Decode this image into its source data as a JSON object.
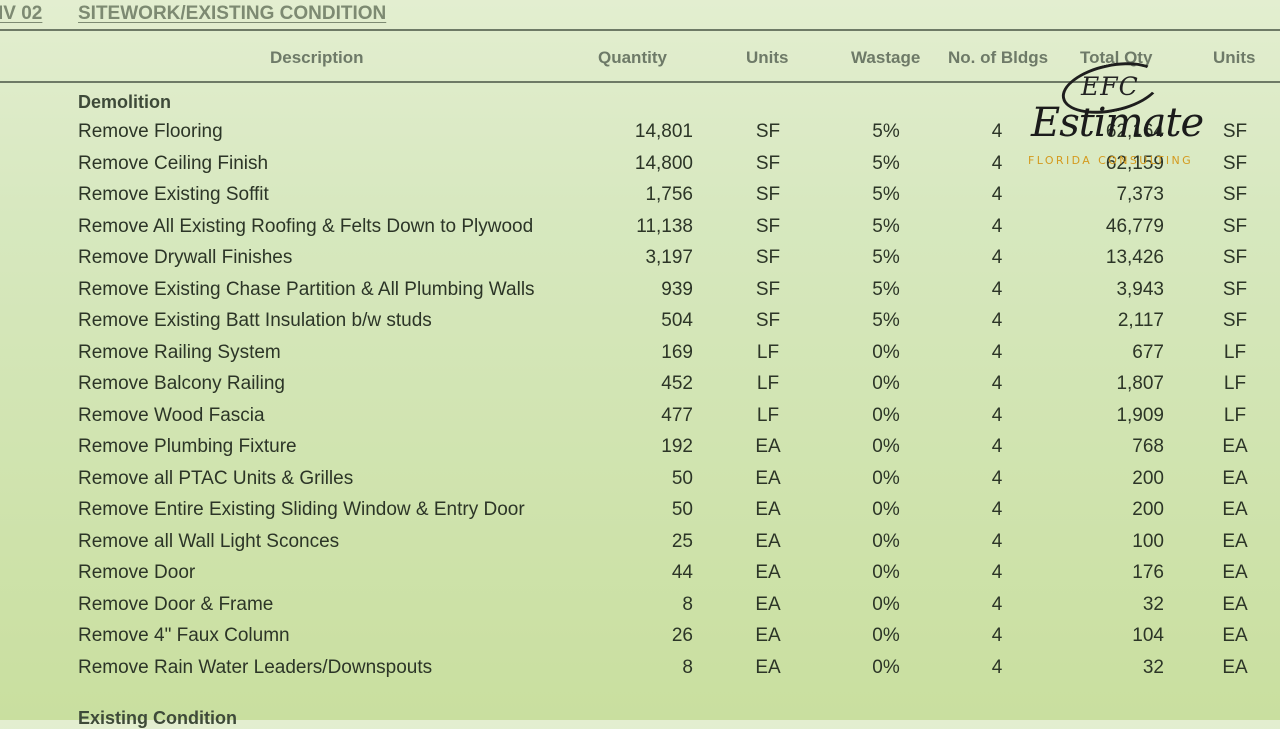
{
  "division": {
    "code": "IV 02",
    "title": "SITEWORK/EXISTING CONDITION"
  },
  "columns": {
    "description": "Description",
    "quantity": "Quantity",
    "units": "Units",
    "wastage": "Wastage",
    "buildings": "No. of Bldgs",
    "total_qty": "Total Qty",
    "total_units": "Units"
  },
  "sections": {
    "demolition": "Demolition",
    "existing": "Existing Condition"
  },
  "rows": [
    {
      "description": "Remove Flooring",
      "quantity": "14,801",
      "units": "SF",
      "wastage": "5%",
      "buildings": "4",
      "total_qty": "62,164",
      "total_units": "SF"
    },
    {
      "description": "Remove Ceiling Finish",
      "quantity": "14,800",
      "units": "SF",
      "wastage": "5%",
      "buildings": "4",
      "total_qty": "62,159",
      "total_units": "SF"
    },
    {
      "description": "Remove Existing Soffit",
      "quantity": "1,756",
      "units": "SF",
      "wastage": "5%",
      "buildings": "4",
      "total_qty": "7,373",
      "total_units": "SF"
    },
    {
      "description": "Remove All Existing Roofing & Felts Down to Plywood",
      "quantity": "11,138",
      "units": "SF",
      "wastage": "5%",
      "buildings": "4",
      "total_qty": "46,779",
      "total_units": "SF"
    },
    {
      "description": "Remove Drywall Finishes",
      "quantity": "3,197",
      "units": "SF",
      "wastage": "5%",
      "buildings": "4",
      "total_qty": "13,426",
      "total_units": "SF"
    },
    {
      "description": "Remove Existing Chase Partition & All Plumbing Walls",
      "quantity": "939",
      "units": "SF",
      "wastage": "5%",
      "buildings": "4",
      "total_qty": "3,943",
      "total_units": "SF"
    },
    {
      "description": "Remove Existing Batt Insulation b/w studs",
      "quantity": "504",
      "units": "SF",
      "wastage": "5%",
      "buildings": "4",
      "total_qty": "2,117",
      "total_units": "SF"
    },
    {
      "description": "Remove Railing System",
      "quantity": "169",
      "units": "LF",
      "wastage": "0%",
      "buildings": "4",
      "total_qty": "677",
      "total_units": "LF"
    },
    {
      "description": "Remove Balcony Railing",
      "quantity": "452",
      "units": "LF",
      "wastage": "0%",
      "buildings": "4",
      "total_qty": "1,807",
      "total_units": "LF"
    },
    {
      "description": "Remove Wood Fascia",
      "quantity": "477",
      "units": "LF",
      "wastage": "0%",
      "buildings": "4",
      "total_qty": "1,909",
      "total_units": "LF"
    },
    {
      "description": "Remove Plumbing Fixture",
      "quantity": "192",
      "units": "EA",
      "wastage": "0%",
      "buildings": "4",
      "total_qty": "768",
      "total_units": "EA"
    },
    {
      "description": "Remove all PTAC Units & Grilles",
      "quantity": "50",
      "units": "EA",
      "wastage": "0%",
      "buildings": "4",
      "total_qty": "200",
      "total_units": "EA"
    },
    {
      "description": "Remove Entire Existing Sliding Window & Entry Door",
      "quantity": "50",
      "units": "EA",
      "wastage": "0%",
      "buildings": "4",
      "total_qty": "200",
      "total_units": "EA"
    },
    {
      "description": "Remove all Wall Light Sconces",
      "quantity": "25",
      "units": "EA",
      "wastage": "0%",
      "buildings": "4",
      "total_qty": "100",
      "total_units": "EA"
    },
    {
      "description": "Remove Door",
      "quantity": "44",
      "units": "EA",
      "wastage": "0%",
      "buildings": "4",
      "total_qty": "176",
      "total_units": "EA"
    },
    {
      "description": "Remove Door & Frame",
      "quantity": "8",
      "units": "EA",
      "wastage": "0%",
      "buildings": "4",
      "total_qty": "32",
      "total_units": "EA"
    },
    {
      "description": "Remove 4\" Faux Column",
      "quantity": "26",
      "units": "EA",
      "wastage": "0%",
      "buildings": "4",
      "total_qty": "104",
      "total_units": "EA"
    },
    {
      "description": "Remove Rain Water Leaders/Downspouts",
      "quantity": "8",
      "units": "EA",
      "wastage": "0%",
      "buildings": "4",
      "total_qty": "32",
      "total_units": "EA"
    }
  ],
  "logo": {
    "monogram": "EFC",
    "wordmark": "Estimate",
    "tagline": "FLORIDA CONSULTING"
  }
}
